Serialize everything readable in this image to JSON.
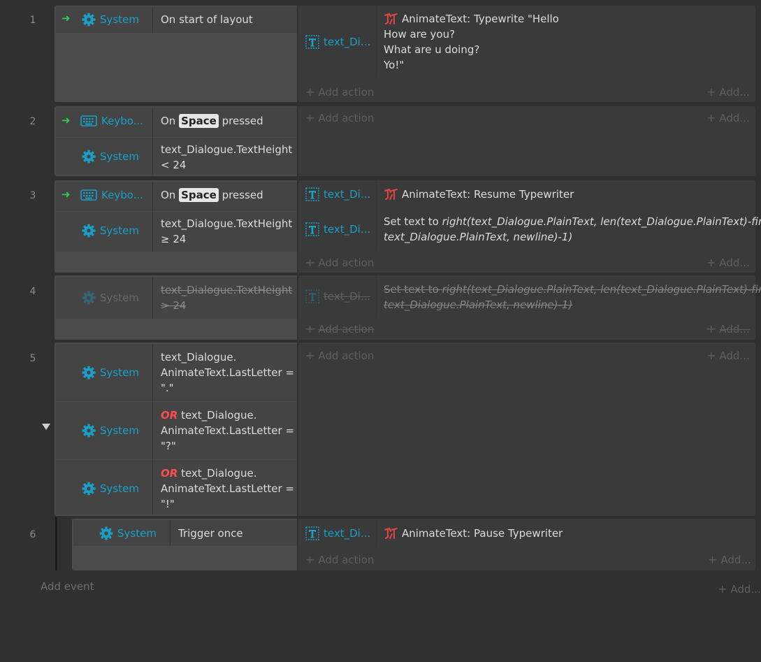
{
  "events": [
    {
      "number": "1",
      "conditions": [
        {
          "object": "System",
          "text": "On start of layout"
        }
      ],
      "actions": [
        {
          "object": "text_Di...",
          "behavior": "AnimateText: Typewrite \"Hello",
          "lines": [
            "How are you?",
            "What are u doing?",
            "Yo!\""
          ]
        }
      ]
    },
    {
      "number": "2",
      "conditions": [
        {
          "object": "Keybo...",
          "pre": "On",
          "key": "Space",
          "post": "pressed"
        },
        {
          "object": "System",
          "line1": "text_Dialogue.TextHeight",
          "line2": "< 24"
        }
      ]
    },
    {
      "number": "3",
      "conditions": [
        {
          "object": "Keybo...",
          "pre": "On",
          "key": "Space",
          "post": "pressed"
        },
        {
          "object": "System",
          "line1": "text_Dialogue.TextHeight",
          "line2": "≥ 24"
        }
      ],
      "actions": [
        {
          "object": "text_Di...",
          "text": "AnimateText: Resume Typewriter"
        },
        {
          "object": "text_Di...",
          "prefix": "Set text to ",
          "expr1": "right(text_Dialogue.PlainText, len(text_Dialogue.PlainText)-find(",
          "expr2": "text_Dialogue.PlainText, newline)-1)"
        }
      ]
    },
    {
      "number": "4",
      "conditions": [
        {
          "object": "System",
          "line1": "text_Dialogue.TextHeight",
          "line2": "> 24"
        }
      ],
      "actions": [
        {
          "object": "text_Di...",
          "prefix": "Set text to ",
          "expr1": "right(text_Dialogue.PlainText, len(text_Dialogue.PlainText)-find(",
          "expr2": "text_Dialogue.PlainText, newline)-1)"
        }
      ]
    },
    {
      "number": "5",
      "conditions": [
        {
          "object": "System",
          "line1": "text_Dialogue.",
          "line2": "AnimateText.LastLetter =",
          "line3": "\".\""
        },
        {
          "object": "System",
          "or": "OR",
          "line1": " text_Dialogue.",
          "line2": "AnimateText.LastLetter =",
          "line3": "\"?\""
        },
        {
          "object": "System",
          "or": "OR",
          "line1": " text_Dialogue.",
          "line2": "AnimateText.LastLetter =",
          "line3": "\"!\""
        }
      ]
    },
    {
      "number": "6",
      "conditions": [
        {
          "object": "System",
          "text": "Trigger once"
        }
      ],
      "actions": [
        {
          "object": "text_Di...",
          "text": "AnimateText: Pause Typewriter"
        }
      ]
    }
  ],
  "add_action_label": "Add action",
  "add_more_label": "Add...",
  "add_event_label": "Add event",
  "colors": {
    "background": "#303030",
    "object": "#19a0c8",
    "or": "#ff4d4d",
    "trigger": "#3cc850"
  },
  "icons": {
    "system": "gear-icon",
    "keyboard": "keyboard-icon",
    "text_object": "text-object-icon",
    "animate_text": "typewriter-behavior-icon",
    "trigger": "trigger-arrow-icon",
    "collapse": "collapse-triangle-icon"
  }
}
